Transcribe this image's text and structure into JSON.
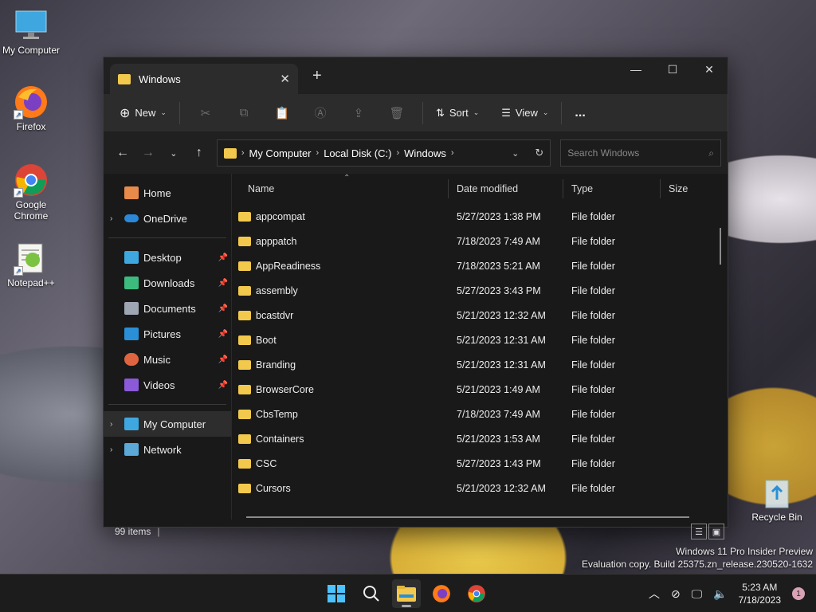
{
  "desktop": {
    "icons": [
      {
        "label": "My Computer"
      },
      {
        "label": "Firefox"
      },
      {
        "label": "Google Chrome"
      },
      {
        "label": "Notepad++"
      },
      {
        "label": "Recycle Bin"
      }
    ],
    "watermark": {
      "line1": "Windows 11 Pro Insider Preview",
      "line2": "Evaluation copy. Build 25375.zn_release.230520-1632"
    }
  },
  "explorer": {
    "tab_title": "Windows",
    "toolbar": {
      "new_label": "New",
      "sort_label": "Sort",
      "view_label": "View",
      "more": "..."
    },
    "address": {
      "crumbs": [
        "My Computer",
        "Local Disk (C:)",
        "Windows"
      ]
    },
    "search": {
      "placeholder": "Search Windows"
    },
    "nav": {
      "home": "Home",
      "onedrive": "OneDrive",
      "quick": [
        "Desktop",
        "Downloads",
        "Documents",
        "Pictures",
        "Music",
        "Videos"
      ],
      "mycomputer": "My Computer",
      "network": "Network"
    },
    "columns": {
      "name": "Name",
      "date": "Date modified",
      "type": "Type",
      "size": "Size"
    },
    "rows": [
      {
        "name": "appcompat",
        "date": "5/27/2023 1:38 PM",
        "type": "File folder"
      },
      {
        "name": "apppatch",
        "date": "7/18/2023 7:49 AM",
        "type": "File folder"
      },
      {
        "name": "AppReadiness",
        "date": "7/18/2023 5:21 AM",
        "type": "File folder"
      },
      {
        "name": "assembly",
        "date": "5/27/2023 3:43 PM",
        "type": "File folder"
      },
      {
        "name": "bcastdvr",
        "date": "5/21/2023 12:32 AM",
        "type": "File folder"
      },
      {
        "name": "Boot",
        "date": "5/21/2023 12:31 AM",
        "type": "File folder"
      },
      {
        "name": "Branding",
        "date": "5/21/2023 12:31 AM",
        "type": "File folder"
      },
      {
        "name": "BrowserCore",
        "date": "5/21/2023 1:49 AM",
        "type": "File folder"
      },
      {
        "name": "CbsTemp",
        "date": "7/18/2023 7:49 AM",
        "type": "File folder"
      },
      {
        "name": "Containers",
        "date": "5/21/2023 1:53 AM",
        "type": "File folder"
      },
      {
        "name": "CSC",
        "date": "5/27/2023 1:43 PM",
        "type": "File folder"
      },
      {
        "name": "Cursors",
        "date": "5/21/2023 12:32 AM",
        "type": "File folder"
      }
    ],
    "status": {
      "count": "99 items"
    }
  },
  "taskbar": {
    "time": "5:23 AM",
    "date": "7/18/2023",
    "notifications": "1"
  }
}
